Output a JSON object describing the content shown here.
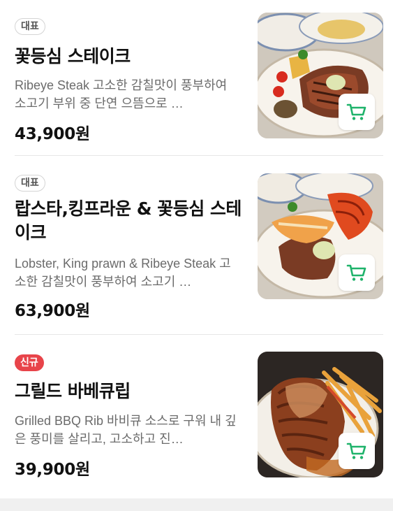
{
  "menu": {
    "items": [
      {
        "badge": "대표",
        "badge_type": "rep",
        "name": "꽃등심 스테이크",
        "description": "Ribeye Steak 고소한 감칠맛이 풍부하여 소고기 부위 중 단연 으뜸으로 …",
        "price": "43,900원",
        "image": "ribeye-steak-plate",
        "cart_icon": "cart-icon"
      },
      {
        "badge": "대표",
        "badge_type": "rep",
        "name": "랍스타,킹프라운 & 꽃등심 스테이크",
        "description": "Lobster, King prawn & Ribeye Steak 고소한 감칠맛이 풍부하여 소고기 …",
        "price": "63,900원",
        "image": "lobster-prawn-steak-plate",
        "cart_icon": "cart-icon"
      },
      {
        "badge": "신규",
        "badge_type": "new",
        "name": "그릴드 바베큐립",
        "description": "Grilled BBQ Rib 바비큐 소스로 구워 내 깊은 풍미를 살리고, 고소하고 진…",
        "price": "39,900원",
        "image": "bbq-rib-plate",
        "cart_icon": "cart-icon"
      }
    ]
  },
  "colors": {
    "new_badge": "#e8444a",
    "cart_icon": "#1fb36b",
    "text_primary": "#111111",
    "text_secondary": "#6b6b6b"
  }
}
